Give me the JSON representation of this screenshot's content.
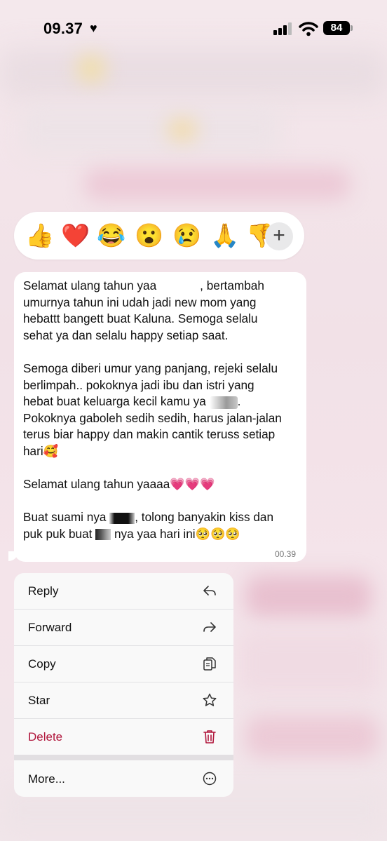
{
  "status_bar": {
    "time": "09.37",
    "battery": "84"
  },
  "reactions": [
    "👍",
    "❤️",
    "😂",
    "😮",
    "😢",
    "🙏",
    "👎"
  ],
  "reactions_more": "+",
  "message": {
    "lines": [
      "Selamat ulang tahun yaa",
      ", bertambah",
      "umurnya tahun ini udah jadi new mom yang",
      "hebattt bangett buat Kaluna. Semoga selalu",
      "sehat ya dan selalu happy setiap saat.",
      "Semoga diberi umur yang panjang, rejeki selalu",
      "berlimpah.. pokoknya jadi ibu dan istri yang",
      "hebat buat keluarga kecil kamu ya",
      ".",
      "Pokoknya gaboleh sedih sedih, harus jalan-jalan",
      "terus biar happy dan makin cantik teruss setiap",
      "hari🥰",
      "Selamat ulang tahun yaaaa💗💗💗",
      "Buat suami nya",
      ", tolong banyakin kiss dan",
      "puk puk buat",
      "nya yaa hari ini🥺🥺🥺"
    ],
    "time": "00.39"
  },
  "menu": {
    "reply": "Reply",
    "forward": "Forward",
    "copy": "Copy",
    "star": "Star",
    "delete": "Delete",
    "more": "More..."
  },
  "colors": {
    "danger": "#b0153b",
    "background": "#f3e4e9"
  }
}
